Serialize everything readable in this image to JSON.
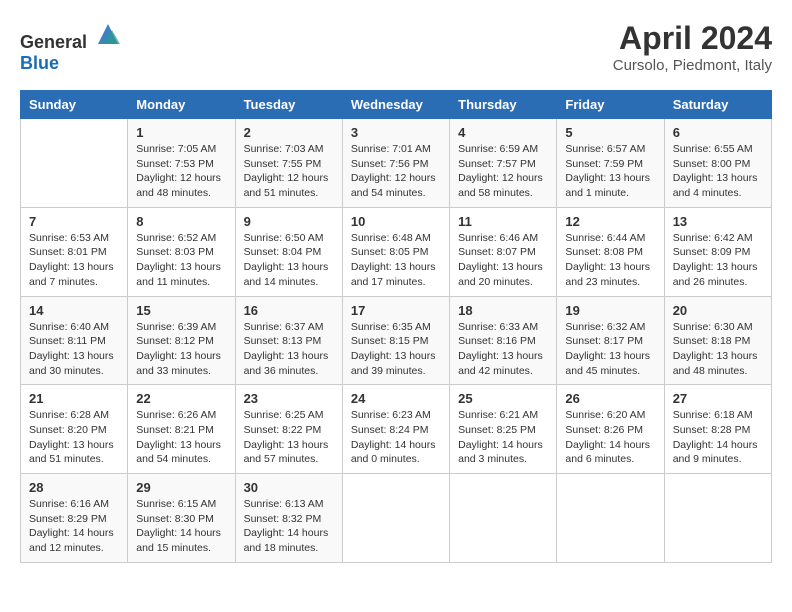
{
  "header": {
    "logo_general": "General",
    "logo_blue": "Blue",
    "title": "April 2024",
    "subtitle": "Cursolo, Piedmont, Italy"
  },
  "columns": [
    "Sunday",
    "Monday",
    "Tuesday",
    "Wednesday",
    "Thursday",
    "Friday",
    "Saturday"
  ],
  "weeks": [
    [
      {
        "day": "",
        "sunrise": "",
        "sunset": "",
        "daylight": ""
      },
      {
        "day": "1",
        "sunrise": "Sunrise: 7:05 AM",
        "sunset": "Sunset: 7:53 PM",
        "daylight": "Daylight: 12 hours and 48 minutes."
      },
      {
        "day": "2",
        "sunrise": "Sunrise: 7:03 AM",
        "sunset": "Sunset: 7:55 PM",
        "daylight": "Daylight: 12 hours and 51 minutes."
      },
      {
        "day": "3",
        "sunrise": "Sunrise: 7:01 AM",
        "sunset": "Sunset: 7:56 PM",
        "daylight": "Daylight: 12 hours and 54 minutes."
      },
      {
        "day": "4",
        "sunrise": "Sunrise: 6:59 AM",
        "sunset": "Sunset: 7:57 PM",
        "daylight": "Daylight: 12 hours and 58 minutes."
      },
      {
        "day": "5",
        "sunrise": "Sunrise: 6:57 AM",
        "sunset": "Sunset: 7:59 PM",
        "daylight": "Daylight: 13 hours and 1 minute."
      },
      {
        "day": "6",
        "sunrise": "Sunrise: 6:55 AM",
        "sunset": "Sunset: 8:00 PM",
        "daylight": "Daylight: 13 hours and 4 minutes."
      }
    ],
    [
      {
        "day": "7",
        "sunrise": "Sunrise: 6:53 AM",
        "sunset": "Sunset: 8:01 PM",
        "daylight": "Daylight: 13 hours and 7 minutes."
      },
      {
        "day": "8",
        "sunrise": "Sunrise: 6:52 AM",
        "sunset": "Sunset: 8:03 PM",
        "daylight": "Daylight: 13 hours and 11 minutes."
      },
      {
        "day": "9",
        "sunrise": "Sunrise: 6:50 AM",
        "sunset": "Sunset: 8:04 PM",
        "daylight": "Daylight: 13 hours and 14 minutes."
      },
      {
        "day": "10",
        "sunrise": "Sunrise: 6:48 AM",
        "sunset": "Sunset: 8:05 PM",
        "daylight": "Daylight: 13 hours and 17 minutes."
      },
      {
        "day": "11",
        "sunrise": "Sunrise: 6:46 AM",
        "sunset": "Sunset: 8:07 PM",
        "daylight": "Daylight: 13 hours and 20 minutes."
      },
      {
        "day": "12",
        "sunrise": "Sunrise: 6:44 AM",
        "sunset": "Sunset: 8:08 PM",
        "daylight": "Daylight: 13 hours and 23 minutes."
      },
      {
        "day": "13",
        "sunrise": "Sunrise: 6:42 AM",
        "sunset": "Sunset: 8:09 PM",
        "daylight": "Daylight: 13 hours and 26 minutes."
      }
    ],
    [
      {
        "day": "14",
        "sunrise": "Sunrise: 6:40 AM",
        "sunset": "Sunset: 8:11 PM",
        "daylight": "Daylight: 13 hours and 30 minutes."
      },
      {
        "day": "15",
        "sunrise": "Sunrise: 6:39 AM",
        "sunset": "Sunset: 8:12 PM",
        "daylight": "Daylight: 13 hours and 33 minutes."
      },
      {
        "day": "16",
        "sunrise": "Sunrise: 6:37 AM",
        "sunset": "Sunset: 8:13 PM",
        "daylight": "Daylight: 13 hours and 36 minutes."
      },
      {
        "day": "17",
        "sunrise": "Sunrise: 6:35 AM",
        "sunset": "Sunset: 8:15 PM",
        "daylight": "Daylight: 13 hours and 39 minutes."
      },
      {
        "day": "18",
        "sunrise": "Sunrise: 6:33 AM",
        "sunset": "Sunset: 8:16 PM",
        "daylight": "Daylight: 13 hours and 42 minutes."
      },
      {
        "day": "19",
        "sunrise": "Sunrise: 6:32 AM",
        "sunset": "Sunset: 8:17 PM",
        "daylight": "Daylight: 13 hours and 45 minutes."
      },
      {
        "day": "20",
        "sunrise": "Sunrise: 6:30 AM",
        "sunset": "Sunset: 8:18 PM",
        "daylight": "Daylight: 13 hours and 48 minutes."
      }
    ],
    [
      {
        "day": "21",
        "sunrise": "Sunrise: 6:28 AM",
        "sunset": "Sunset: 8:20 PM",
        "daylight": "Daylight: 13 hours and 51 minutes."
      },
      {
        "day": "22",
        "sunrise": "Sunrise: 6:26 AM",
        "sunset": "Sunset: 8:21 PM",
        "daylight": "Daylight: 13 hours and 54 minutes."
      },
      {
        "day": "23",
        "sunrise": "Sunrise: 6:25 AM",
        "sunset": "Sunset: 8:22 PM",
        "daylight": "Daylight: 13 hours and 57 minutes."
      },
      {
        "day": "24",
        "sunrise": "Sunrise: 6:23 AM",
        "sunset": "Sunset: 8:24 PM",
        "daylight": "Daylight: 14 hours and 0 minutes."
      },
      {
        "day": "25",
        "sunrise": "Sunrise: 6:21 AM",
        "sunset": "Sunset: 8:25 PM",
        "daylight": "Daylight: 14 hours and 3 minutes."
      },
      {
        "day": "26",
        "sunrise": "Sunrise: 6:20 AM",
        "sunset": "Sunset: 8:26 PM",
        "daylight": "Daylight: 14 hours and 6 minutes."
      },
      {
        "day": "27",
        "sunrise": "Sunrise: 6:18 AM",
        "sunset": "Sunset: 8:28 PM",
        "daylight": "Daylight: 14 hours and 9 minutes."
      }
    ],
    [
      {
        "day": "28",
        "sunrise": "Sunrise: 6:16 AM",
        "sunset": "Sunset: 8:29 PM",
        "daylight": "Daylight: 14 hours and 12 minutes."
      },
      {
        "day": "29",
        "sunrise": "Sunrise: 6:15 AM",
        "sunset": "Sunset: 8:30 PM",
        "daylight": "Daylight: 14 hours and 15 minutes."
      },
      {
        "day": "30",
        "sunrise": "Sunrise: 6:13 AM",
        "sunset": "Sunset: 8:32 PM",
        "daylight": "Daylight: 14 hours and 18 minutes."
      },
      {
        "day": "",
        "sunrise": "",
        "sunset": "",
        "daylight": ""
      },
      {
        "day": "",
        "sunrise": "",
        "sunset": "",
        "daylight": ""
      },
      {
        "day": "",
        "sunrise": "",
        "sunset": "",
        "daylight": ""
      },
      {
        "day": "",
        "sunrise": "",
        "sunset": "",
        "daylight": ""
      }
    ]
  ]
}
